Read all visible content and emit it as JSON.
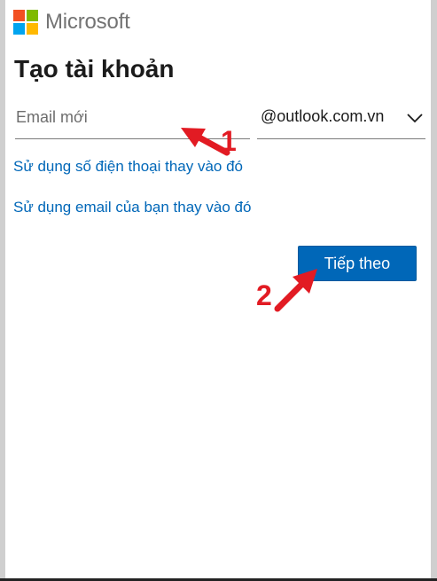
{
  "brand": {
    "name": "Microsoft",
    "logo_colors": [
      "#f25022",
      "#7fba00",
      "#00a4ef",
      "#ffb900"
    ]
  },
  "page": {
    "title": "Tạo tài khoản"
  },
  "form": {
    "email_placeholder": "Email mới",
    "email_value": "",
    "domain_selected": "@outlook.com.vn"
  },
  "links": {
    "use_phone": "Sử dụng số điện thoại thay vào đó",
    "use_existing_email": "Sử dụng email của bạn thay vào đó"
  },
  "buttons": {
    "next": "Tiếp theo"
  },
  "annotations": {
    "step1": "1",
    "step2": "2",
    "color": "#e21b23"
  },
  "colors": {
    "accent": "#0067b8",
    "link": "#0067b8"
  }
}
